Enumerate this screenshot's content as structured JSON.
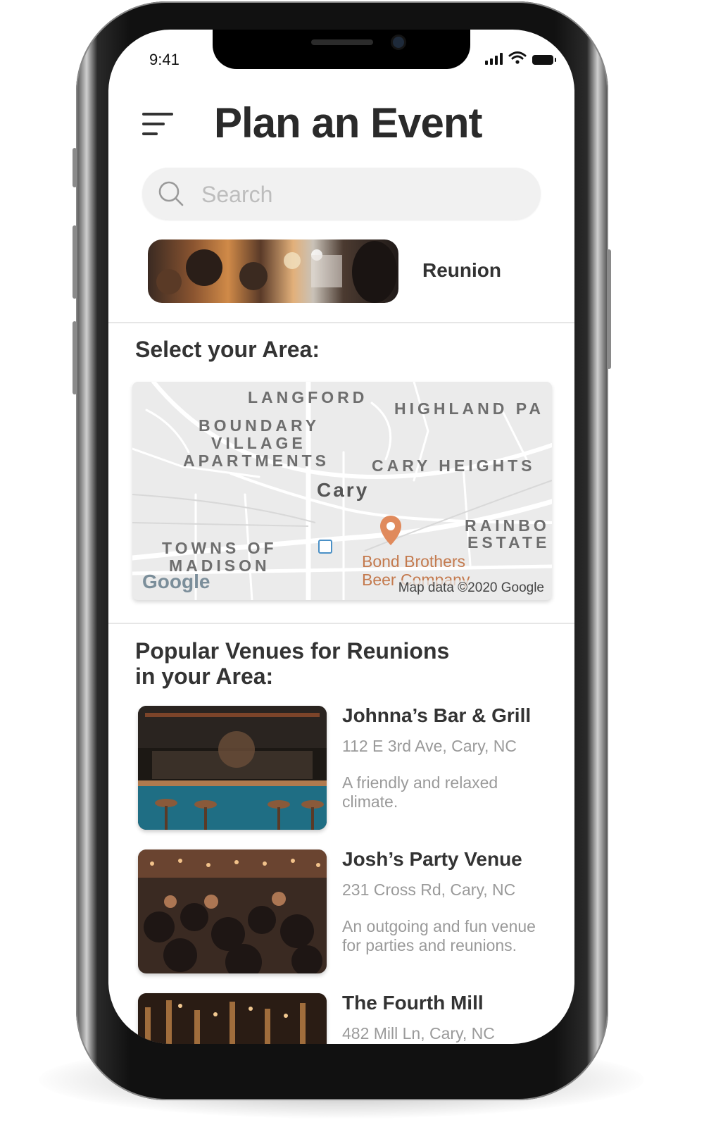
{
  "status": {
    "time": "9:41"
  },
  "header": {
    "title": "Plan an Event"
  },
  "search": {
    "placeholder": "Search"
  },
  "event": {
    "label": "Reunion"
  },
  "area": {
    "title": "Select your Area:",
    "map": {
      "labels": [
        {
          "text": "LANGFORD"
        },
        {
          "text": "HIGHLAND PA"
        },
        {
          "text": "BOUNDARY"
        },
        {
          "text": "VILLAGE"
        },
        {
          "text": "APARTMENTS"
        },
        {
          "text": "CARY HEIGHTS"
        },
        {
          "text": "RAINBO"
        },
        {
          "text": "ESTATE"
        },
        {
          "text": "TOWNS OF"
        },
        {
          "text": "MADISON"
        }
      ],
      "city": "Cary",
      "poi_line1": "Bond Brothers",
      "poi_line2": "Beer Company",
      "logo": "Google",
      "attribution": "Map data ©2020 Google",
      "colors": {
        "pin": "#e08a5c",
        "poi_text": "#c47a4e",
        "transit": "#4a90c6"
      }
    }
  },
  "venues": {
    "title_line1": "Popular Venues for Reunions",
    "title_line2": "in your Area:",
    "items": [
      {
        "name": "Johnna’s Bar & Grill",
        "address": "112 E 3rd Ave, Cary, NC",
        "description": "A friendly and relaxed climate."
      },
      {
        "name": "Josh’s Party Venue",
        "address": "231 Cross Rd, Cary, NC",
        "description": "An outgoing and fun venue for parties and reunions."
      },
      {
        "name": "The Fourth Mill",
        "address": "482 Mill Ln, Cary, NC",
        "description": ""
      }
    ]
  }
}
